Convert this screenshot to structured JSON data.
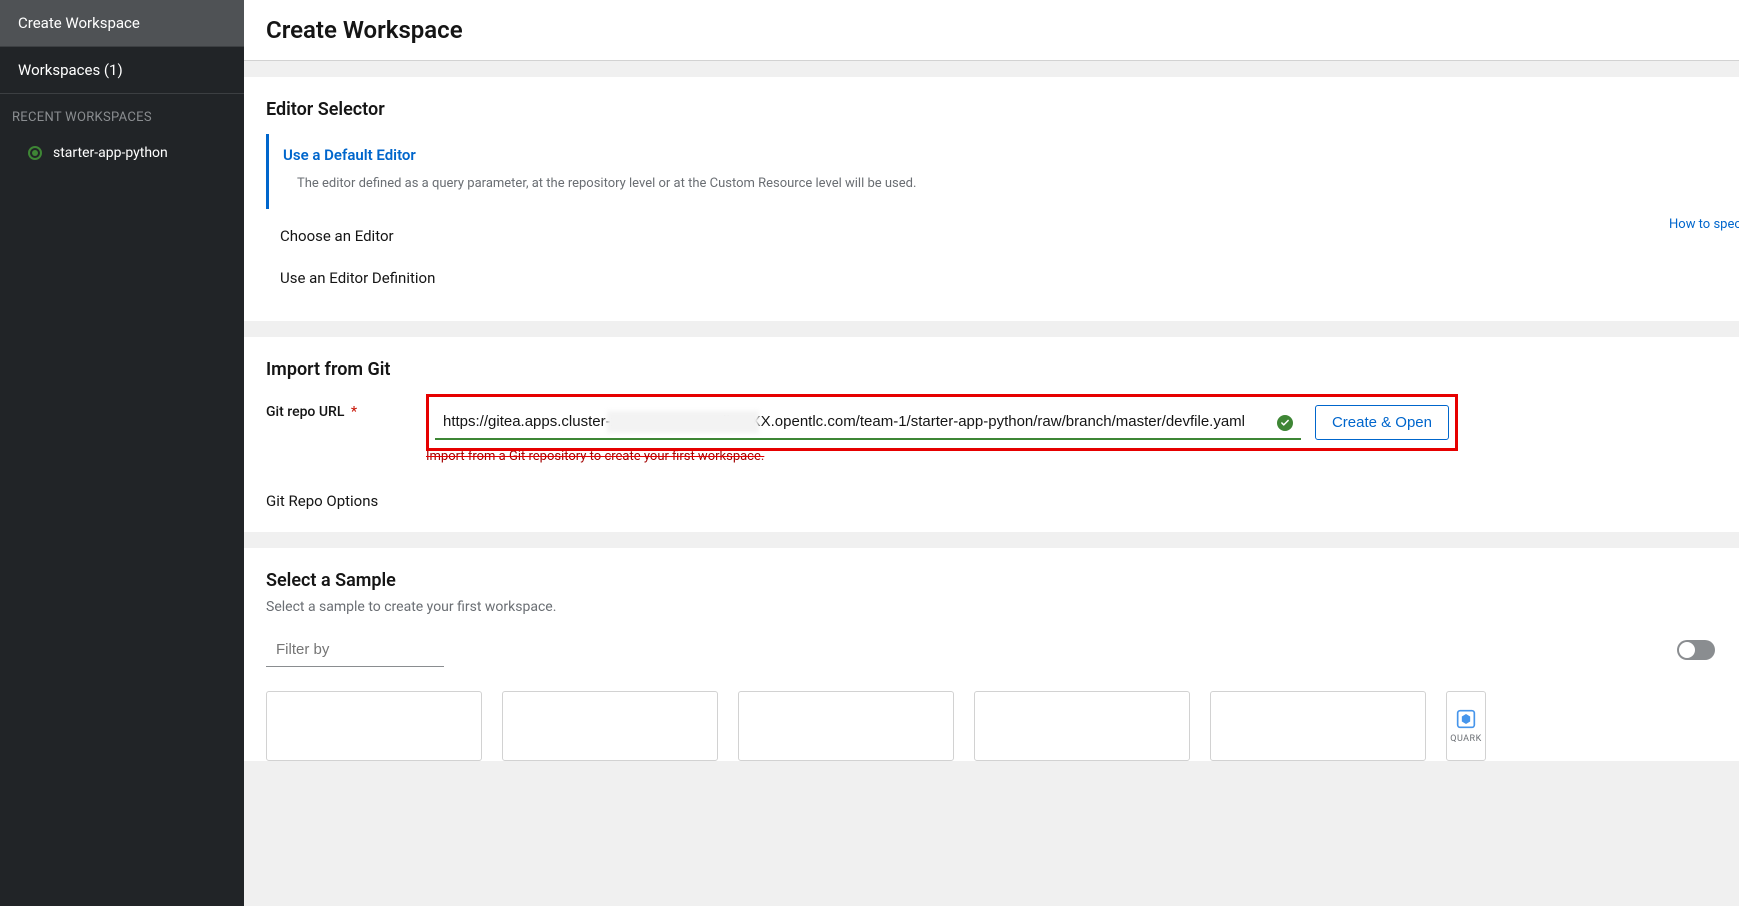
{
  "sidebar": {
    "create_workspace": "Create Workspace",
    "workspaces_label": "Workspaces (1)",
    "recent_header": "RECENT WORKSPACES",
    "recent_items": [
      {
        "name": "starter-app-python"
      }
    ]
  },
  "page": {
    "title": "Create Workspace"
  },
  "editor": {
    "section_title": "Editor Selector",
    "default_label": "Use a Default Editor",
    "default_desc": "The editor defined as a query parameter, at the repository level or at the Custom Resource level will be used.",
    "choose_label": "Choose an Editor",
    "definition_label": "Use an Editor Definition",
    "how_to_link": "How to speci"
  },
  "git": {
    "section_title": "Import from Git",
    "url_label": "Git repo URL",
    "url_value": "https://gitea.apps.cluster-xxxxx.xxxxx.sandboxXX.opentlc.com/team-1/starter-app-python/raw/branch/master/devfile.yaml",
    "create_button": "Create & Open",
    "help_text": "Import from a Git repository to create your first workspace.",
    "options_label": "Git Repo Options"
  },
  "samples": {
    "section_title": "Select a Sample",
    "section_subtitle": "Select a sample to create your first workspace.",
    "filter_placeholder": "Filter by",
    "tile_labels": {
      "quarkus": "QUARK"
    }
  }
}
